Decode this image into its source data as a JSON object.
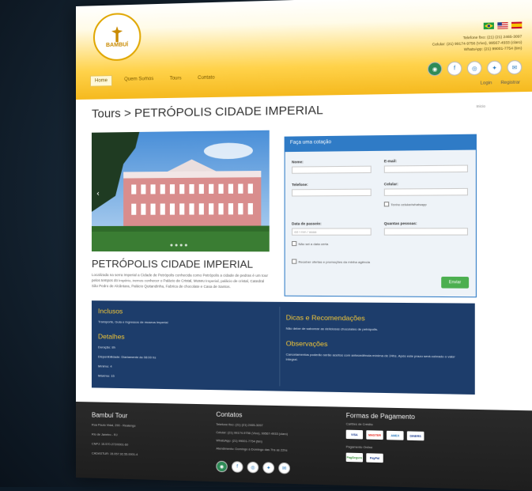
{
  "header": {
    "logo_text": "BAMBUÍ",
    "contact_lines": [
      "Telefone fixo: (21) (21) 2465-3097",
      "Celular: (21) 99174-9756 (Vivo), 99567-4933 (claro)",
      "WhatsApp: (21) 99001-7754 (tim)"
    ],
    "flags": [
      "br-flag",
      "us-flag",
      "es-flag"
    ],
    "social": [
      "tripadvisor-icon",
      "facebook-icon",
      "instagram-icon",
      "twitter-icon",
      "email-icon"
    ]
  },
  "nav": {
    "items": [
      {
        "label": "Home",
        "active": true
      },
      {
        "label": "Quem Somos",
        "active": false
      },
      {
        "label": "Tours",
        "active": false
      },
      {
        "label": "Contato",
        "active": false
      }
    ],
    "login": "Login",
    "register": "Registrar"
  },
  "page": {
    "title": "Tours > PETRÓPOLIS CIDADE IMPERIAL",
    "breadcrumb": "Inicio",
    "tour_name": "PETRÓPOLIS CIDADE IMPERIAL",
    "description": "Localizada na serra Imperial a Cidade de Petrópolis conhecida como Petrópolis a cidade de pedras é um tour pelos tempos do império, iremos conhecer o Palácio de Cristal, Museu Imperial, palácio de cristal, Catedral São Pedro de Alcântara, Palácio Quitandinha, Fabrica de chocolate e Casa de Santos."
  },
  "form": {
    "header": "Faça uma cotação",
    "name_label": "Nome:",
    "email_label": "E-mail:",
    "phone_label": "Telefone:",
    "mobile_label": "Celular:",
    "whatsapp_label": "Tenho celular/whatsapp",
    "date_label": "Data de passeio:",
    "date_placeholder": "dd / mm / aaaa",
    "people_label": "Quantas pessoas:",
    "newsletter_label": "Não sei a data certa",
    "offers_label": "Receber ofertas e promoções da minha agência",
    "send_label": "Enviar"
  },
  "info": {
    "inclusos_title": "Inclusos",
    "inclusos_text": "Transporte, Guia e Ingressos de museus Imperial",
    "detalhes_title": "Detalhes",
    "duracao": "Duração: 8h",
    "disponibilidade": "Disponibilidade: Diariamente às 08:00 hs",
    "minimo": "Mínimo: 4",
    "maximo": "Máximo: 15",
    "dicas_title": "Dicas e Recomendações",
    "dicas_text": "Não deixe de saborear as deliciosas chocolates de petrópolis.",
    "obs_title": "Observações",
    "obs_text": "Cancelamentos poderão serão aceitos com antecedência mínima de 24hs. Após este prazo será cobrado o valor integral."
  },
  "footer": {
    "company_title": "Bambuí Tour",
    "company_lines": [
      "Rua Paulo Vidal, 290 - Realengo",
      "Rio de Janeiro - RJ",
      "CNPJ: 15.570.272/0001-60",
      "CADASTUR: 15.057.92.55.0001-4"
    ],
    "contacts_title": "Contatos",
    "contacts_lines": [
      "Telefone fixo: (21) (21) 2465-3097",
      "Celular: (21) 99174-9756 (Vivo), 99567-4933 (claro)",
      "WhatsApp: (21) 99001-7754 (tim)",
      "Atendimento: Domingo à Domingo das 7hs as 22hs"
    ],
    "payment_title": "Formas de Pagamento",
    "payment_sub1": "Cartões de Crédito",
    "payment_sub2": "Pagamento Online",
    "cards": [
      "VISA",
      "MASTER",
      "AMEX",
      "DINERS"
    ],
    "online": [
      "PagSeguro",
      "PayPal"
    ]
  }
}
